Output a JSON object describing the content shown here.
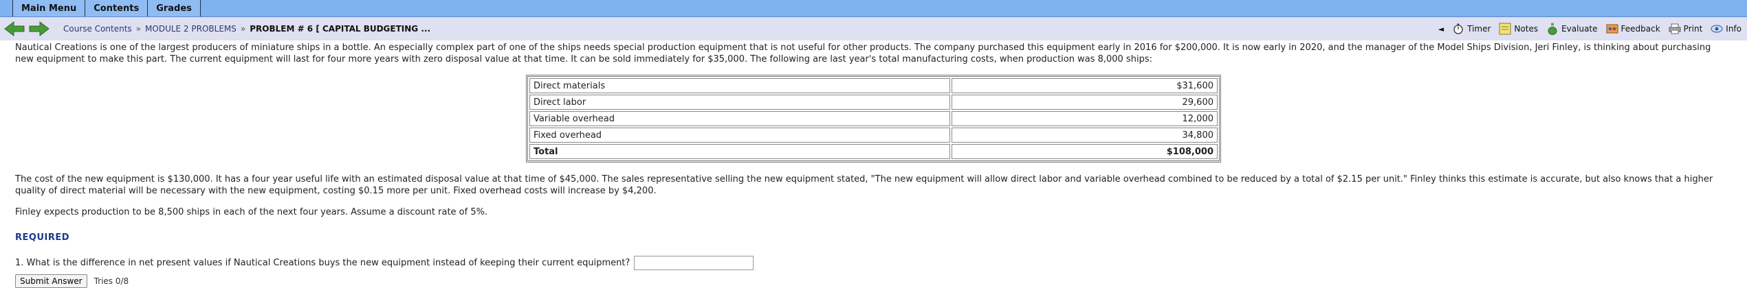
{
  "menubar": {
    "items": [
      "Main Menu",
      "Contents",
      "Grades"
    ]
  },
  "nav": {
    "breadcrumb": [
      "Course Contents",
      "MODULE 2 PROBLEMS",
      "PROBLEM # 6 [ CAPITAL BUDGETING ..."
    ],
    "separator": "»",
    "tools": [
      "Timer",
      "Notes",
      "Evaluate",
      "Feedback",
      "Print",
      "Info"
    ],
    "collapse_glyph": "◄"
  },
  "problem": {
    "intro": "Nautical Creations is one of the largest producers of miniature ships in a bottle. An especially complex part of one of the ships needs special production equipment that is not useful for other products. The company purchased this equipment early in 2016 for $200,000. It is now early in 2020, and the manager of the Model Ships Division, Jeri Finley, is thinking about purchasing new equipment to make this part. The current equipment will last for four more years with zero disposal value at that time. It can be sold immediately for $35,000. The following are last year's total manufacturing costs, when production was 8,000 ships:",
    "costs": [
      {
        "label": "Direct materials",
        "value": "$31,600"
      },
      {
        "label": "Direct labor",
        "value": "29,600"
      },
      {
        "label": "Variable overhead",
        "value": "12,000"
      },
      {
        "label": "Fixed overhead",
        "value": "34,800"
      },
      {
        "label": "Total",
        "value": "$108,000"
      }
    ],
    "para2": "The cost of the new equipment is $130,000. It has a four year useful life with an estimated disposal value at that time of $45,000. The sales representative selling the new equipment stated, \"The new equipment will allow direct labor and variable overhead combined to be reduced by a total of $2.15 per unit.\" Finley thinks this estimate is accurate, but also knows that a higher quality of direct material will be necessary with the new equipment, costing $0.15 more per unit. Fixed overhead costs will increase by $4,200.",
    "para3": "Finley expects production to be 8,500 ships in each of the next four years. Assume a discount rate of 5%.",
    "required_label": "REQUIRED",
    "question": "1. What is the difference in net present values if Nautical Creations buys the new equipment instead of keeping their current equipment?",
    "answer_value": "",
    "submit_label": "Submit Answer",
    "tries": "Tries 0/8"
  },
  "colors": {
    "menubar": "#7fb3f0",
    "navbar": "#dfe0f2",
    "nav_arrow": "#4a9a3a",
    "required": "#1a3a8a"
  }
}
